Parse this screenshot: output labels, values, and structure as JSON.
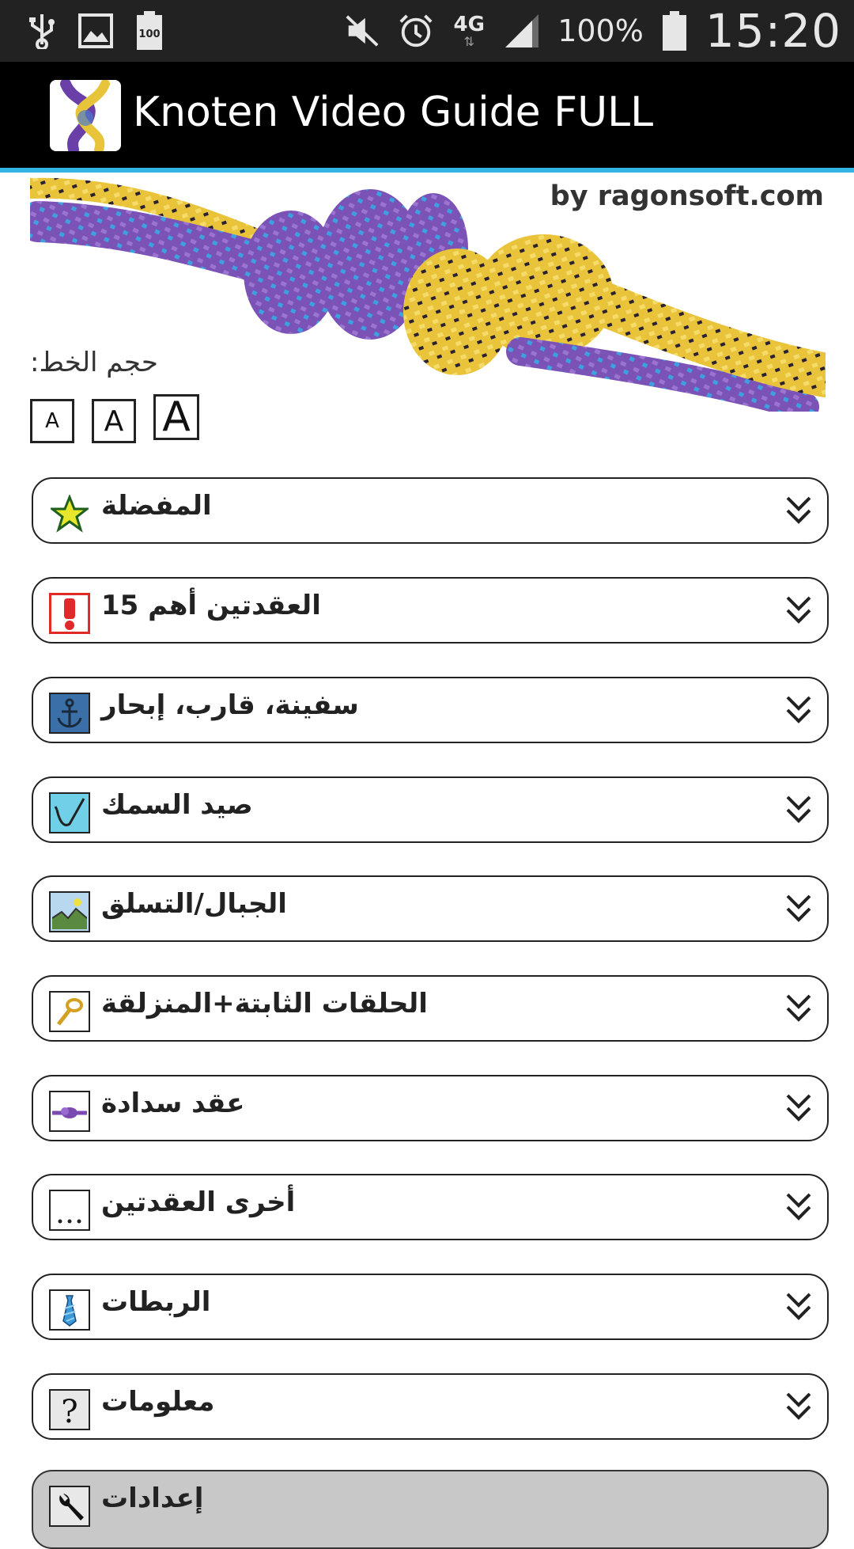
{
  "status_bar": {
    "battery_percent": "100%",
    "time": "15:20",
    "network": "4G",
    "icons": [
      "usb-icon",
      "image-icon",
      "battery-100-icon",
      "mute-icon",
      "alarm-icon",
      "signal-icon",
      "battery-icon"
    ]
  },
  "action_bar": {
    "title": "Knoten Video Guide FULL",
    "accent_color": "#33b5e5"
  },
  "header": {
    "byline": "by ragonsoft.com",
    "font_size_label": ":حجم الخط",
    "font_buttons": [
      "A",
      "A",
      "A"
    ]
  },
  "categories": [
    {
      "label": "المفضلة",
      "icon": "star-icon"
    },
    {
      "label": "العقدتين أهم 15",
      "icon": "exclamation-icon"
    },
    {
      "label": "سفينة، قارب، إبحار",
      "icon": "anchor-icon"
    },
    {
      "label": "صيد السمك",
      "icon": "fishing-icon"
    },
    {
      "label": "الجبال/التسلق",
      "icon": "mountain-icon"
    },
    {
      "label": "الحلقات الثابتة+المنزلقة",
      "icon": "loop-icon"
    },
    {
      "label": "عقد سدادة",
      "icon": "stopper-knot-icon"
    },
    {
      "label": "أخرى العقدتين",
      "icon": "ellipsis-icon"
    },
    {
      "label": "الربطات",
      "icon": "tie-icon"
    },
    {
      "label": "معلومات",
      "icon": "question-icon"
    },
    {
      "label": "إعدادات",
      "icon": "wrench-icon"
    }
  ]
}
